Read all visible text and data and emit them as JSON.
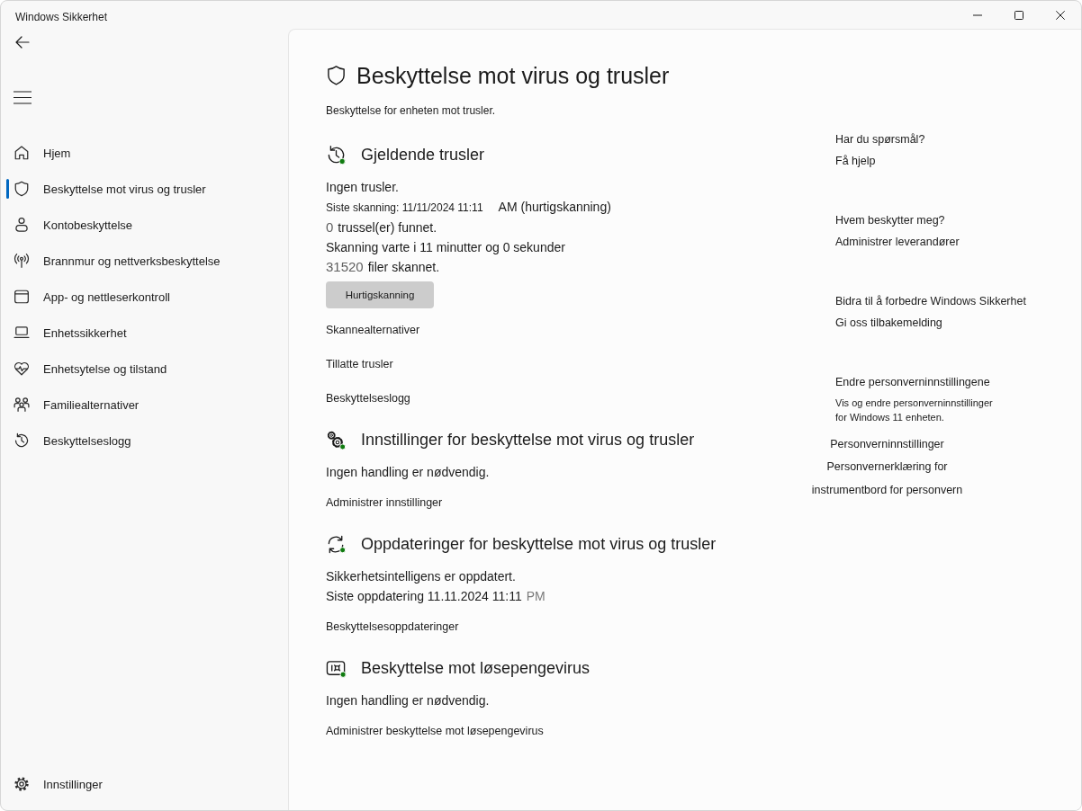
{
  "window": {
    "title": "Windows Sikkerhet"
  },
  "sidebar": {
    "items": [
      {
        "label": "Hjem",
        "selected": false
      },
      {
        "label": "Beskyttelse mot virus og trusler",
        "selected": true
      },
      {
        "label": "Kontobeskyttelse",
        "selected": false
      },
      {
        "label": "Brannmur og nettverksbeskyttelse",
        "selected": false
      },
      {
        "label": "App- og nettleserkontroll",
        "selected": false
      },
      {
        "label": "Enhetssikkerhet",
        "selected": false
      },
      {
        "label": "Enhetsytelse og tilstand",
        "selected": false
      },
      {
        "label": "Familiealternativer",
        "selected": false
      },
      {
        "label": "Beskyttelseslogg",
        "selected": false
      }
    ],
    "settings": "Innstillinger"
  },
  "page": {
    "title": "Beskyttelse mot virus og trusler",
    "subtitle": "Beskyttelse for enheten mot trusler."
  },
  "sections": [
    {
      "heading": "Gjeldende trusler",
      "lines": [
        [
          {
            "kind": "text",
            "text": "Ingen trusler."
          }
        ],
        [
          {
            "kind": "small",
            "text": "Siste skanning: 11/11/2024 11:11"
          },
          {
            "kind": "text",
            "text": "AM (hurtigskanning)"
          }
        ],
        [
          {
            "kind": "count",
            "text": "0"
          },
          {
            "kind": "text",
            "text": "trussel(er) funnet."
          }
        ],
        [
          {
            "kind": "text",
            "text": "Skanning varte i 11 minutter og 0 sekunder"
          }
        ],
        [
          {
            "kind": "count",
            "text": "31520"
          },
          {
            "kind": "text",
            "text": "filer skannet."
          }
        ]
      ],
      "button": "Hurtigskanning",
      "links": [
        "Skannealternativer",
        "Tillatte trusler",
        "Beskyttelseslogg"
      ]
    },
    {
      "heading": "Innstillinger for beskyttelse mot virus og trusler",
      "lines": [
        [
          {
            "kind": "text",
            "text": "Ingen handling er nødvendig."
          }
        ]
      ],
      "links": [
        "Administrer innstillinger"
      ]
    },
    {
      "heading": "Oppdateringer for beskyttelse mot virus og trusler",
      "lines": [
        [
          {
            "kind": "text",
            "text": "Sikkerhetsintelligens er oppdatert."
          }
        ],
        [
          {
            "kind": "text",
            "text": "Siste oppdatering 11.11.2024 11:11"
          },
          {
            "kind": "faded",
            "text": "PM"
          }
        ]
      ],
      "links": [
        "Beskyttelsesoppdateringer"
      ]
    },
    {
      "heading": "Beskyttelse mot løsepengevirus",
      "lines": [
        [
          {
            "kind": "text",
            "text": "Ingen handling er nødvendig."
          }
        ]
      ],
      "links": [
        "Administrer beskyttelse mot løsepengevirus"
      ]
    }
  ],
  "aside": [
    {
      "heading": "Har du spørsmål?",
      "links": [
        "Få hjelp"
      ]
    },
    {
      "heading": "Hvem beskytter meg?",
      "links": [
        "Administrer leverandører"
      ]
    },
    {
      "heading": "Bidra til å forbedre Windows Sikkerhet",
      "links": [
        "Gi oss tilbakemelding"
      ]
    },
    {
      "heading": "Endre personverninnstillingene",
      "description": "Vis og endre personverninnstillinger for Windows 11 enheten.",
      "links": [
        "Personverninnstillinger",
        "Personvernerklæring for instrumentbord for personvern"
      ]
    }
  ]
}
